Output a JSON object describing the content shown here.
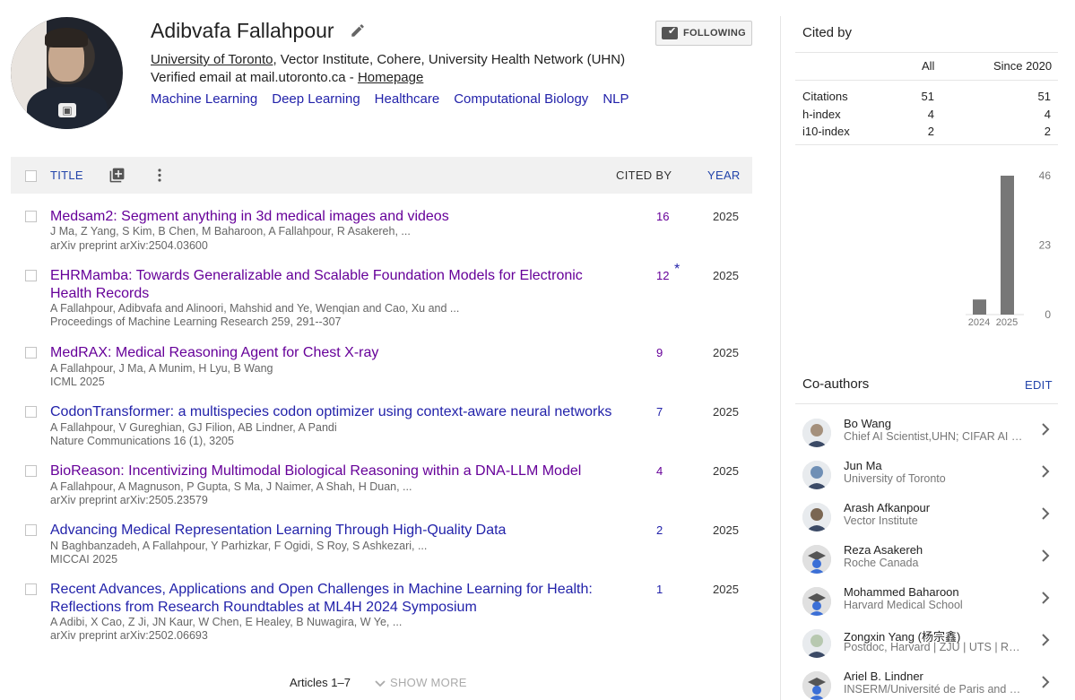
{
  "profile": {
    "name": "Adibvafa Fallahpour",
    "affiliation_link": "University of Toronto",
    "affiliation_rest": ", Vector Institute, Cohere, University Health Network (UHN)",
    "email_text": "Verified email at mail.utoronto.ca - ",
    "homepage_label": "Homepage",
    "interests": [
      "Machine Learning",
      "Deep Learning",
      "Healthcare",
      "Computational Biology",
      "NLP"
    ],
    "follow_label": "FOLLOWING"
  },
  "table_header": {
    "title_label": "TITLE",
    "cited_by_label": "CITED BY",
    "year_label": "YEAR"
  },
  "articles": [
    {
      "title": "Medsam2: Segment anything in 3d medical images and videos",
      "authors": "J Ma, Z Yang, S Kim, B Chen, M Baharoon, A Fallahpour, R Asakereh, ...",
      "venue": "arXiv preprint arXiv:2504.03600",
      "cited_by": "16",
      "year": "2025"
    },
    {
      "title": "EHRMamba: Towards Generalizable and Scalable Foundation Models for Electronic Health Records",
      "authors": "A Fallahpour, Adibvafa and Alinoori, Mahshid and Ye, Wenqian and Cao, Xu and ...",
      "venue": "Proceedings of Machine Learning Research 259, 291--307",
      "cited_by": "12",
      "star": "*",
      "year": "2025"
    },
    {
      "title": "MedRAX: Medical Reasoning Agent for Chest X-ray",
      "authors": "A Fallahpour, J Ma, A Munim, H Lyu, B Wang",
      "venue": "ICML 2025",
      "cited_by": "9",
      "year": "2025"
    },
    {
      "title": "CodonTransformer: a multispecies codon optimizer using context-aware neural networks",
      "authors": "A Fallahpour, V Gureghian, GJ Filion, AB Lindner, A Pandi",
      "venue": "Nature Communications 16 (1), 3205",
      "cited_by": "7",
      "year": "2025"
    },
    {
      "title": "BioReason: Incentivizing Multimodal Biological Reasoning within a DNA-LLM Model",
      "authors": "A Fallahpour, A Magnuson, P Gupta, S Ma, J Naimer, A Shah, H Duan, ...",
      "venue": "arXiv preprint arXiv:2505.23579",
      "cited_by": "4",
      "year": "2025"
    },
    {
      "title": "Advancing Medical Representation Learning Through High-Quality Data",
      "authors": "N Baghbanzadeh, A Fallahpour, Y Parhizkar, F Ogidi, S Roy, S Ashkezari, ...",
      "venue": "MICCAI 2025",
      "cited_by": "2",
      "year": "2025"
    },
    {
      "title": "Recent Advances, Applications and Open Challenges in Machine Learning for Health: Reflections from Research Roundtables at ML4H 2024 Symposium",
      "authors": "A Adibi, X Cao, Z Ji, JN Kaur, W Chen, E Healey, B Nuwagira, W Ye, ...",
      "venue": "arXiv preprint arXiv:2502.06693",
      "cited_by": "1",
      "year": "2025"
    }
  ],
  "footer": {
    "articles_count": "Articles 1–7",
    "show_more_label": "SHOW MORE"
  },
  "cited_by": {
    "title": "Cited by",
    "col_all": "All",
    "col_since": "Since 2020",
    "rows": [
      {
        "label": "Citations",
        "all": "51",
        "since": "51"
      },
      {
        "label": "h-index",
        "all": "4",
        "since": "4"
      },
      {
        "label": "i10-index",
        "all": "2",
        "since": "2"
      }
    ]
  },
  "chart_data": {
    "type": "bar",
    "categories": [
      "2024",
      "2025"
    ],
    "values": [
      5,
      46
    ],
    "ylim": [
      0,
      46
    ],
    "yticks": [
      "46",
      "23",
      "0"
    ],
    "color": "#777777"
  },
  "coauthors": {
    "title": "Co-authors",
    "edit_label": "EDIT",
    "items": [
      {
        "name": "Bo Wang",
        "affiliation": "Chief AI Scientist,UHN; CIFAR AI Chair,Vector Institute; Assistant Professor",
        "photo": true
      },
      {
        "name": "Jun Ma",
        "affiliation": "University of Toronto",
        "photo": true
      },
      {
        "name": "Arash Afkanpour",
        "affiliation": "Vector Institute",
        "photo": true
      },
      {
        "name": "Reza Asakereh",
        "affiliation": "Roche Canada",
        "photo": false
      },
      {
        "name": "Mohammed Baharoon",
        "affiliation": "Harvard Medical School",
        "photo": false
      },
      {
        "name": "Zongxin Yang (杨宗鑫)",
        "affiliation": "Postdoc, Harvard | ZJU | UTS | ReLER",
        "photo": true
      },
      {
        "name": "Ariel B. Lindner",
        "affiliation": "INSERM/Université de Paris and Learning Planet Institute",
        "photo": false
      }
    ]
  }
}
